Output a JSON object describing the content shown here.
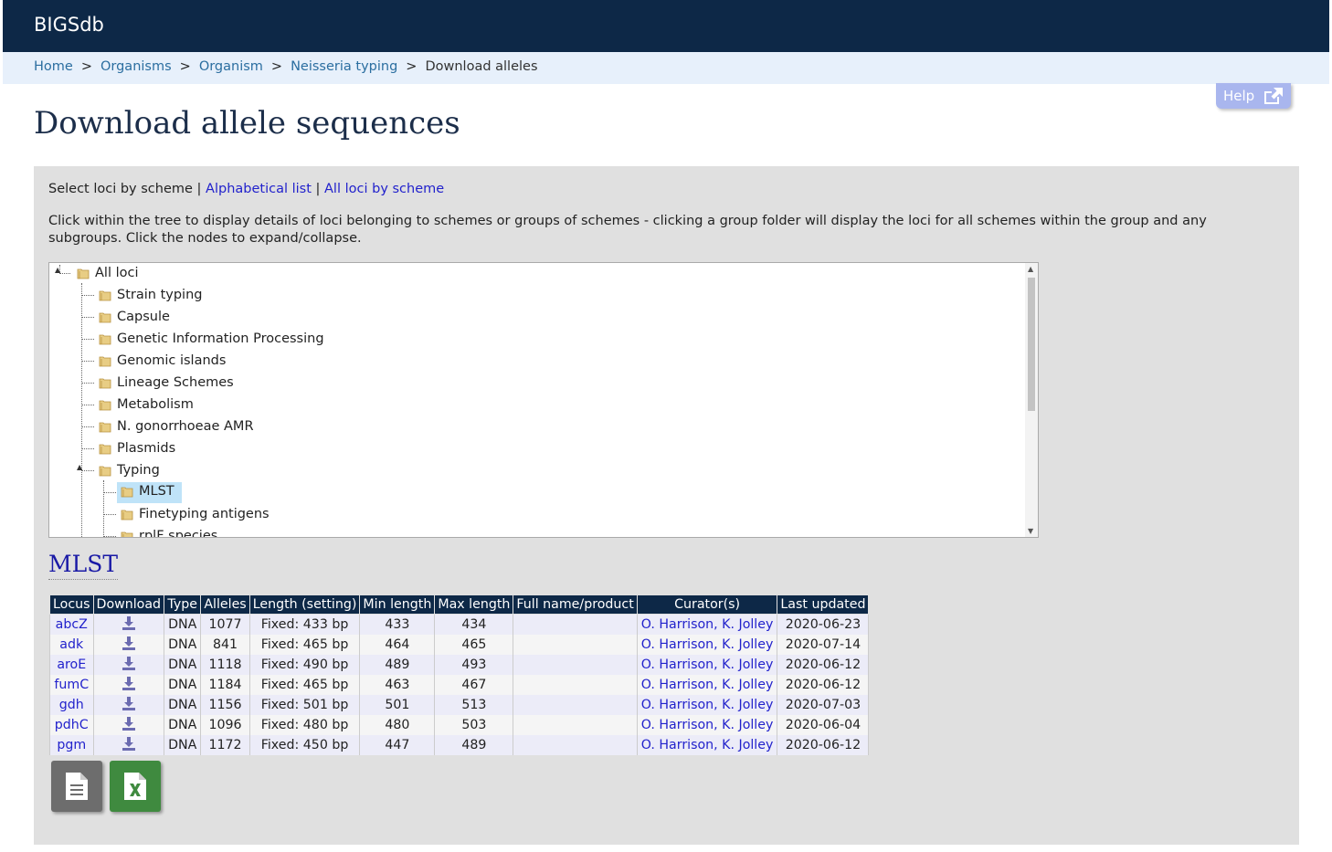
{
  "header": {
    "brand": "BIGSdb"
  },
  "breadcrumb": {
    "items": [
      "Home",
      "Organisms",
      "Organism",
      "Neisseria typing"
    ],
    "current": "Download alleles",
    "separator": ">"
  },
  "help": {
    "label": "Help"
  },
  "page": {
    "title": "Download allele sequences"
  },
  "selector": {
    "prefix": "Select loci by scheme",
    "sep": "|",
    "links": [
      "Alphabetical list",
      "All loci by scheme"
    ]
  },
  "instructions": "Click within the tree to display details of loci belonging to schemes or groups of schemes - clicking a group folder will display the loci for all schemes within the group and any subgroups. Click the nodes to expand/collapse.",
  "tree": {
    "root": "All loci",
    "groups": [
      "Strain typing",
      "Capsule",
      "Genetic Information Processing",
      "Genomic islands",
      "Lineage Schemes",
      "Metabolism",
      "N. gonorrhoeae AMR",
      "Plasmids",
      "Typing"
    ],
    "typing_children": [
      "MLST",
      "Finetyping antigens",
      "rplF species"
    ],
    "selected": "MLST"
  },
  "section": {
    "title": "MLST"
  },
  "table": {
    "headers": [
      "Locus",
      "Download",
      "Type",
      "Alleles",
      "Length (setting)",
      "Min length",
      "Max length",
      "Full name/product",
      "Curator(s)",
      "Last updated"
    ],
    "rows": [
      {
        "locus": "abcZ",
        "type": "DNA",
        "alleles": "1077",
        "length": "Fixed: 433 bp",
        "min": "433",
        "max": "434",
        "full_name": "",
        "curators": "O. Harrison, K. Jolley",
        "updated": "2020-06-23"
      },
      {
        "locus": "adk",
        "type": "DNA",
        "alleles": "841",
        "length": "Fixed: 465 bp",
        "min": "464",
        "max": "465",
        "full_name": "",
        "curators": "O. Harrison, K. Jolley",
        "updated": "2020-07-14"
      },
      {
        "locus": "aroE",
        "type": "DNA",
        "alleles": "1118",
        "length": "Fixed: 490 bp",
        "min": "489",
        "max": "493",
        "full_name": "",
        "curators": "O. Harrison, K. Jolley",
        "updated": "2020-06-12"
      },
      {
        "locus": "fumC",
        "type": "DNA",
        "alleles": "1184",
        "length": "Fixed: 465 bp",
        "min": "463",
        "max": "467",
        "full_name": "",
        "curators": "O. Harrison, K. Jolley",
        "updated": "2020-06-12"
      },
      {
        "locus": "gdh",
        "type": "DNA",
        "alleles": "1156",
        "length": "Fixed: 501 bp",
        "min": "501",
        "max": "513",
        "full_name": "",
        "curators": "O. Harrison, K. Jolley",
        "updated": "2020-07-03"
      },
      {
        "locus": "pdhC",
        "type": "DNA",
        "alleles": "1096",
        "length": "Fixed: 480 bp",
        "min": "480",
        "max": "503",
        "full_name": "",
        "curators": "O. Harrison, K. Jolley",
        "updated": "2020-06-04"
      },
      {
        "locus": "pgm",
        "type": "DNA",
        "alleles": "1172",
        "length": "Fixed: 450 bp",
        "min": "447",
        "max": "489",
        "full_name": "",
        "curators": "O. Harrison, K. Jolley",
        "updated": "2020-06-12"
      }
    ]
  },
  "export_buttons": [
    {
      "icon": "text-file-icon",
      "color": "#6d6d6d"
    },
    {
      "icon": "excel-file-icon",
      "color": "#3f8a3f"
    }
  ],
  "colors": {
    "topbar": "#0d2847",
    "breadcrumb_bg": "#e7f0fb",
    "panel": "#e0e0e0",
    "link": "#2222cc",
    "selected_node": "#bfe3f8"
  }
}
